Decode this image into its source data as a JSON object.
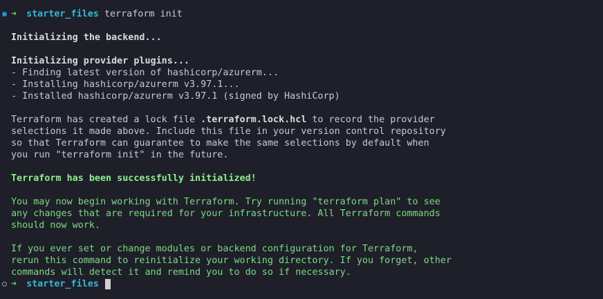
{
  "prompt1": {
    "arrow": "➜",
    "dir": "starter_files",
    "command": "terraform init"
  },
  "output": {
    "backend": "Initializing the backend...",
    "plugins_heading": "Initializing provider plugins...",
    "plugin_lines": [
      "- Finding latest version of hashicorp/azurerm...",
      "- Installing hashicorp/azurerm v3.97.1...",
      "- Installed hashicorp/azurerm v3.97.1 (signed by HashiCorp)"
    ],
    "lock_pre": "Terraform has created a lock file ",
    "lock_file": ".terraform.lock.hcl",
    "lock_post": " to record the provider",
    "lock_lines": [
      "selections it made above. Include this file in your version control repository",
      "so that Terraform can guarantee to make the same selections by default when",
      "you run \"terraform init\" in the future."
    ],
    "success": "Terraform has been successfully initialized!",
    "begin_lines": [
      "You may now begin working with Terraform. Try running \"terraform plan\" to see",
      "any changes that are required for your infrastructure. All Terraform commands",
      "should now work."
    ],
    "modules_lines": [
      "If you ever set or change modules or backend configuration for Terraform,",
      "rerun this command to reinitialize your working directory. If you forget, other",
      "commands will detect it and remind you to do so if necessary."
    ]
  },
  "prompt2": {
    "arrow": "➜",
    "dir": "starter_files"
  },
  "colors": {
    "background": "#1e1f29",
    "text": "#c8cad4",
    "green": "#7ddb82",
    "dir": "#35b8d8",
    "arrow": "#5fd07a"
  }
}
